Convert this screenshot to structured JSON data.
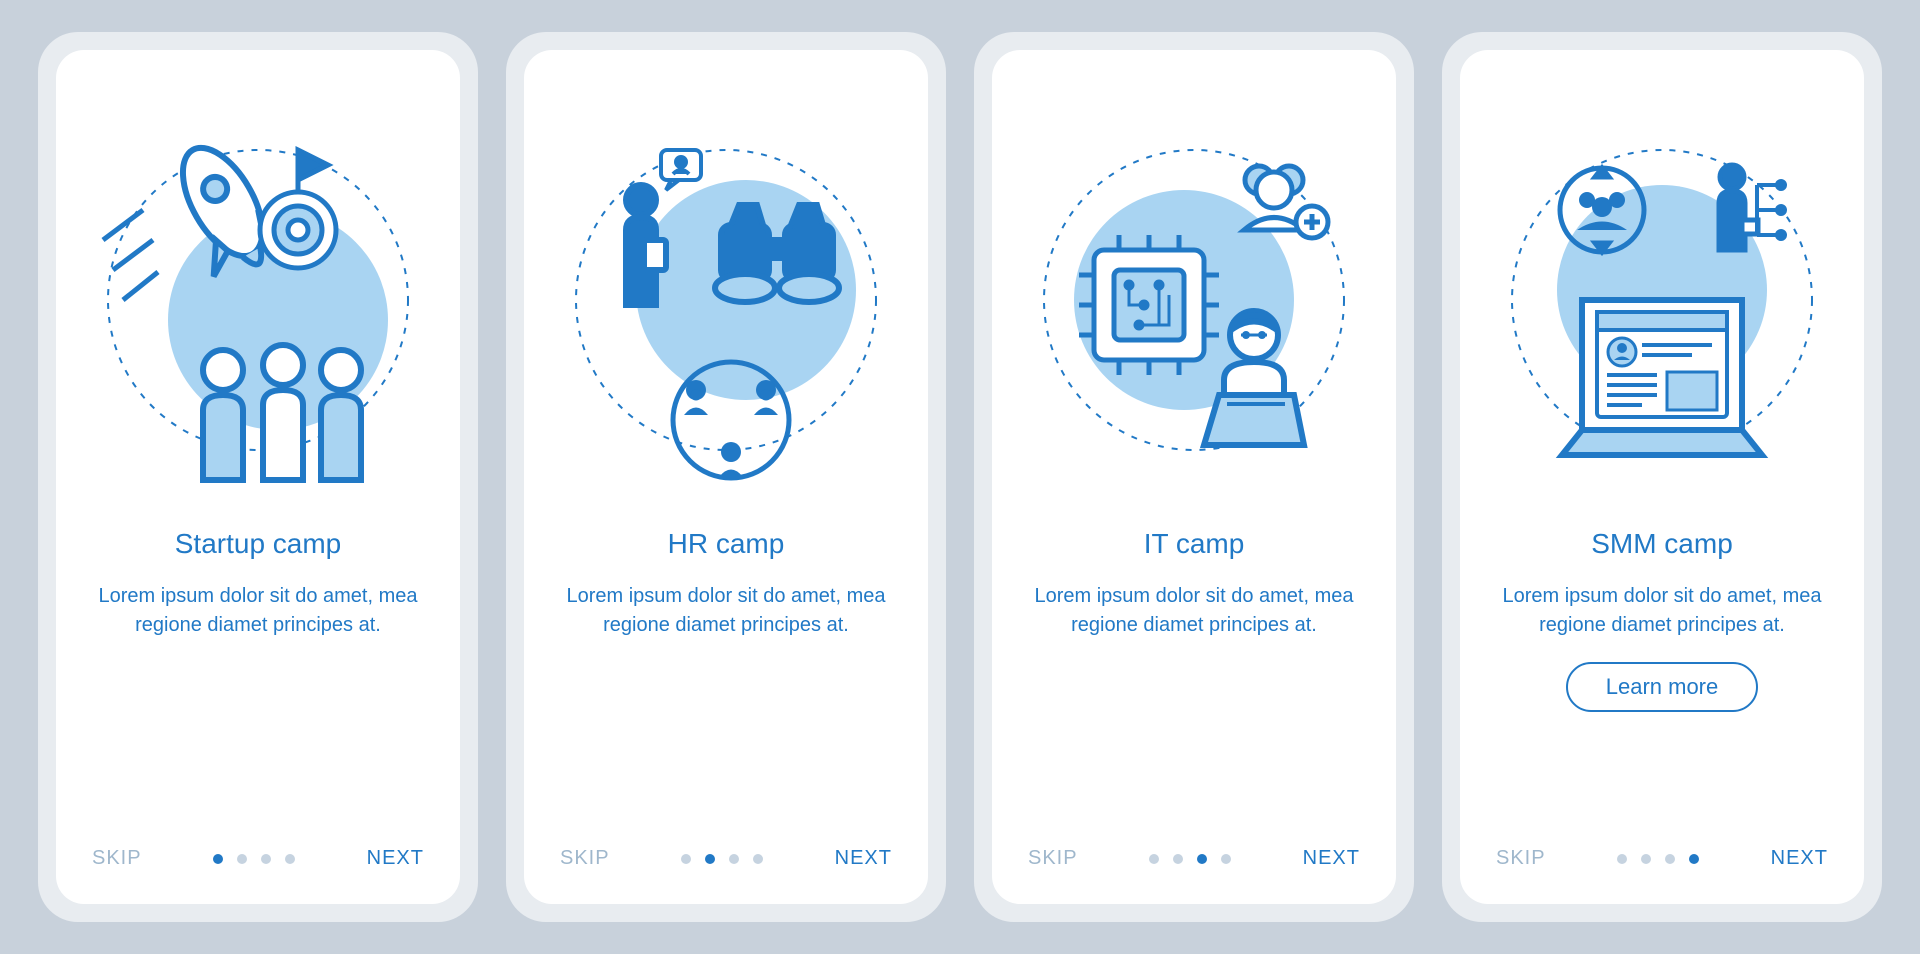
{
  "colors": {
    "primary": "#2179c6",
    "primaryLight": "#a9d4f2",
    "muted": "#9fb7cc"
  },
  "screens": [
    {
      "icon": "startup-icon",
      "title": "Startup camp",
      "desc": "Lorem ipsum dolor sit do amet, mea regione diamet principes at.",
      "activeDot": 0,
      "showLearnMore": false
    },
    {
      "icon": "hr-icon",
      "title": "HR camp",
      "desc": "Lorem ipsum dolor sit do amet, mea regione diamet principes at.",
      "activeDot": 1,
      "showLearnMore": false
    },
    {
      "icon": "it-icon",
      "title": "IT camp",
      "desc": "Lorem ipsum dolor sit do amet, mea regione diamet principes at.",
      "activeDot": 2,
      "showLearnMore": false
    },
    {
      "icon": "smm-icon",
      "title": "SMM camp",
      "desc": "Lorem ipsum dolor sit do amet, mea regione diamet principes at.",
      "activeDot": 3,
      "showLearnMore": true
    }
  ],
  "nav": {
    "skip": "SKIP",
    "next": "NEXT",
    "learnMore": "Learn more",
    "dotCount": 4
  }
}
